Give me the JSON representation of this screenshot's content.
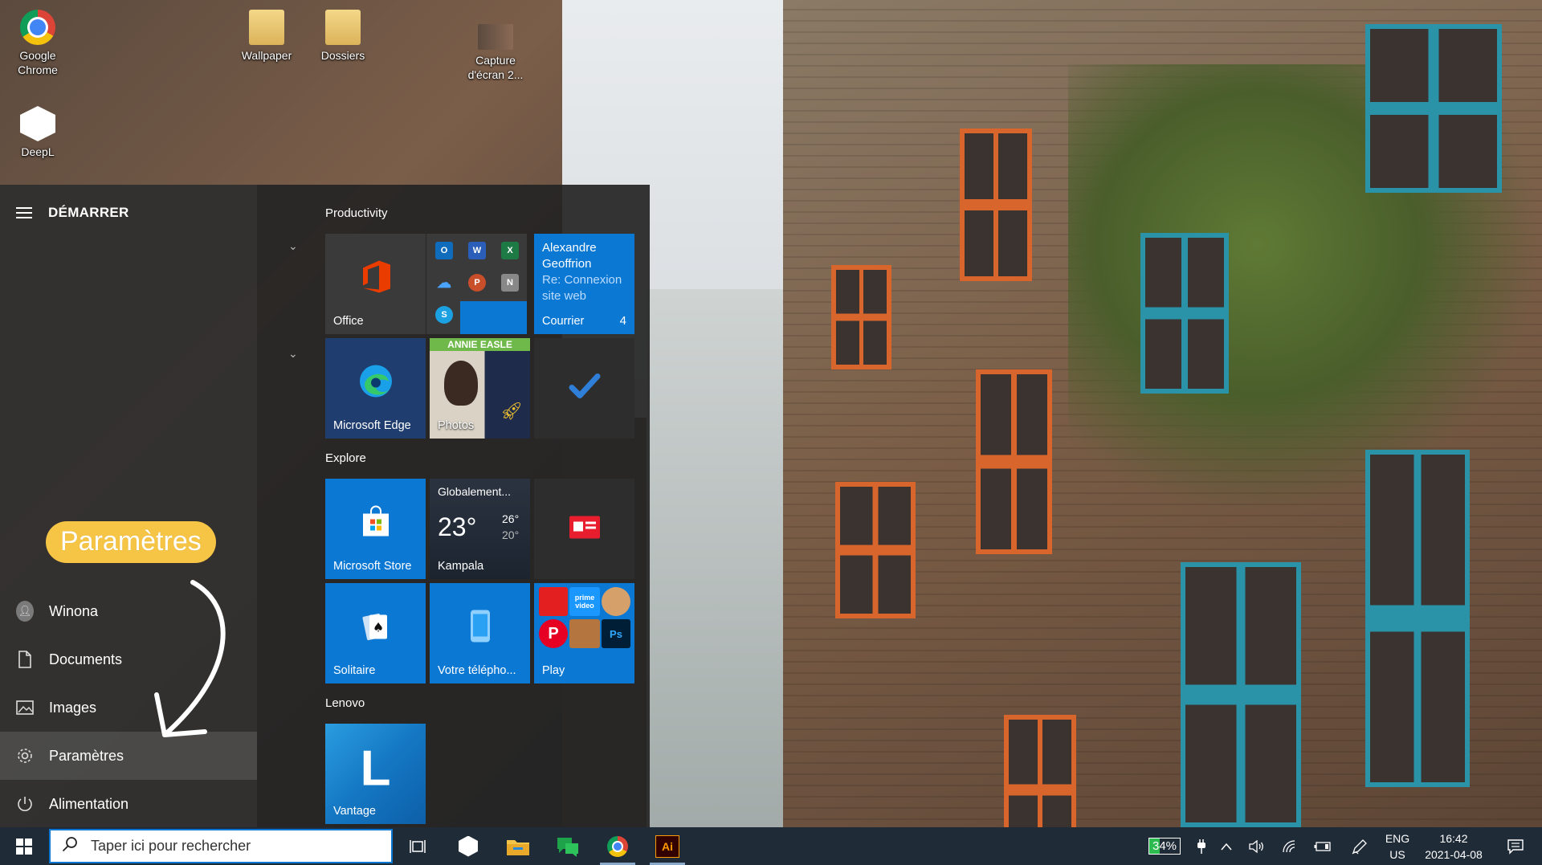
{
  "desktop": {
    "icons": [
      {
        "label": "Google Chrome",
        "icon": "chrome-icon"
      },
      {
        "label": "Wallpaper",
        "icon": "folder-icon"
      },
      {
        "label": "Dossiers",
        "icon": "folder-icon"
      },
      {
        "label": "Capture d'écran 2...",
        "icon": "image-file-icon"
      },
      {
        "label": "DeepL",
        "icon": "deepl-icon"
      }
    ]
  },
  "start_menu": {
    "title": "DÉMARRER",
    "nav": {
      "user": "Winona",
      "documents": "Documents",
      "images": "Images",
      "settings": "Paramètres",
      "power": "Alimentation"
    },
    "callout": "Paramètres",
    "groups": {
      "productivity": "Productivity",
      "explore": "Explore",
      "lenovo": "Lenovo"
    },
    "tiles": {
      "office": "Office",
      "mail_sender_1": "Alexandre",
      "mail_sender_2": "Geoffrion",
      "mail_subject_1": "Re: Connexion",
      "mail_subject_2": "site web",
      "mail_app": "Courrier",
      "mail_count": "4",
      "edge": "Microsoft Edge",
      "photos": "Photos",
      "photos_banner": "ANNIE EASLE",
      "store": "Microsoft Store",
      "weather_title": "Globalement...",
      "weather_temp": "23°",
      "weather_high": "26°",
      "weather_low": "20°",
      "weather_city": "Kampala",
      "solitaire": "Solitaire",
      "phone": "Votre télépho...",
      "play": "Play",
      "play_prime_1": "prime",
      "play_prime_2": "video",
      "play_ps": "Ps",
      "vantage": "Vantage",
      "vantage_letter": "L"
    },
    "office_apps": {
      "outlook": "O",
      "word": "W",
      "excel": "X",
      "powerpoint": "P",
      "onenote": "N",
      "skype": "S"
    }
  },
  "taskbar": {
    "search_placeholder": "Taper ici pour rechercher",
    "battery": "34%",
    "lang_1": "ENG",
    "lang_2": "US",
    "time": "16:42",
    "date": "2021-04-08",
    "illustrator": "Ai"
  },
  "colors": {
    "accent": "#0b78d4",
    "callout": "#f6c545",
    "taskbar": "#202b38"
  }
}
